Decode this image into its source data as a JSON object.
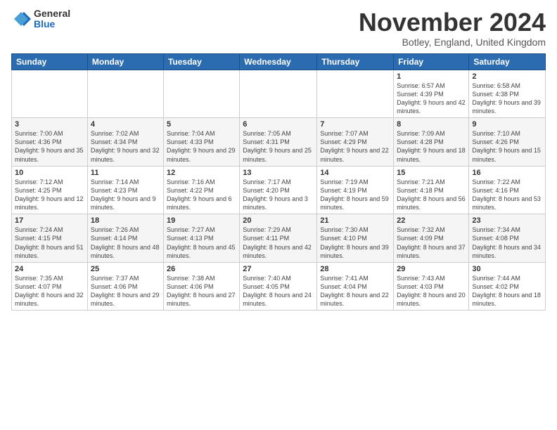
{
  "header": {
    "logo": {
      "general": "General",
      "blue": "Blue"
    },
    "title": "November 2024",
    "location": "Botley, England, United Kingdom"
  },
  "weekdays": [
    "Sunday",
    "Monday",
    "Tuesday",
    "Wednesday",
    "Thursday",
    "Friday",
    "Saturday"
  ],
  "weeks": [
    [
      {
        "day": "",
        "info": ""
      },
      {
        "day": "",
        "info": ""
      },
      {
        "day": "",
        "info": ""
      },
      {
        "day": "",
        "info": ""
      },
      {
        "day": "",
        "info": ""
      },
      {
        "day": "1",
        "info": "Sunrise: 6:57 AM\nSunset: 4:39 PM\nDaylight: 9 hours\nand 42 minutes."
      },
      {
        "day": "2",
        "info": "Sunrise: 6:58 AM\nSunset: 4:38 PM\nDaylight: 9 hours\nand 39 minutes."
      }
    ],
    [
      {
        "day": "3",
        "info": "Sunrise: 7:00 AM\nSunset: 4:36 PM\nDaylight: 9 hours\nand 35 minutes."
      },
      {
        "day": "4",
        "info": "Sunrise: 7:02 AM\nSunset: 4:34 PM\nDaylight: 9 hours\nand 32 minutes."
      },
      {
        "day": "5",
        "info": "Sunrise: 7:04 AM\nSunset: 4:33 PM\nDaylight: 9 hours\nand 29 minutes."
      },
      {
        "day": "6",
        "info": "Sunrise: 7:05 AM\nSunset: 4:31 PM\nDaylight: 9 hours\nand 25 minutes."
      },
      {
        "day": "7",
        "info": "Sunrise: 7:07 AM\nSunset: 4:29 PM\nDaylight: 9 hours\nand 22 minutes."
      },
      {
        "day": "8",
        "info": "Sunrise: 7:09 AM\nSunset: 4:28 PM\nDaylight: 9 hours\nand 18 minutes."
      },
      {
        "day": "9",
        "info": "Sunrise: 7:10 AM\nSunset: 4:26 PM\nDaylight: 9 hours\nand 15 minutes."
      }
    ],
    [
      {
        "day": "10",
        "info": "Sunrise: 7:12 AM\nSunset: 4:25 PM\nDaylight: 9 hours\nand 12 minutes."
      },
      {
        "day": "11",
        "info": "Sunrise: 7:14 AM\nSunset: 4:23 PM\nDaylight: 9 hours\nand 9 minutes."
      },
      {
        "day": "12",
        "info": "Sunrise: 7:16 AM\nSunset: 4:22 PM\nDaylight: 9 hours\nand 6 minutes."
      },
      {
        "day": "13",
        "info": "Sunrise: 7:17 AM\nSunset: 4:20 PM\nDaylight: 9 hours\nand 3 minutes."
      },
      {
        "day": "14",
        "info": "Sunrise: 7:19 AM\nSunset: 4:19 PM\nDaylight: 8 hours\nand 59 minutes."
      },
      {
        "day": "15",
        "info": "Sunrise: 7:21 AM\nSunset: 4:18 PM\nDaylight: 8 hours\nand 56 minutes."
      },
      {
        "day": "16",
        "info": "Sunrise: 7:22 AM\nSunset: 4:16 PM\nDaylight: 8 hours\nand 53 minutes."
      }
    ],
    [
      {
        "day": "17",
        "info": "Sunrise: 7:24 AM\nSunset: 4:15 PM\nDaylight: 8 hours\nand 51 minutes."
      },
      {
        "day": "18",
        "info": "Sunrise: 7:26 AM\nSunset: 4:14 PM\nDaylight: 8 hours\nand 48 minutes."
      },
      {
        "day": "19",
        "info": "Sunrise: 7:27 AM\nSunset: 4:13 PM\nDaylight: 8 hours\nand 45 minutes."
      },
      {
        "day": "20",
        "info": "Sunrise: 7:29 AM\nSunset: 4:11 PM\nDaylight: 8 hours\nand 42 minutes."
      },
      {
        "day": "21",
        "info": "Sunrise: 7:30 AM\nSunset: 4:10 PM\nDaylight: 8 hours\nand 39 minutes."
      },
      {
        "day": "22",
        "info": "Sunrise: 7:32 AM\nSunset: 4:09 PM\nDaylight: 8 hours\nand 37 minutes."
      },
      {
        "day": "23",
        "info": "Sunrise: 7:34 AM\nSunset: 4:08 PM\nDaylight: 8 hours\nand 34 minutes."
      }
    ],
    [
      {
        "day": "24",
        "info": "Sunrise: 7:35 AM\nSunset: 4:07 PM\nDaylight: 8 hours\nand 32 minutes."
      },
      {
        "day": "25",
        "info": "Sunrise: 7:37 AM\nSunset: 4:06 PM\nDaylight: 8 hours\nand 29 minutes."
      },
      {
        "day": "26",
        "info": "Sunrise: 7:38 AM\nSunset: 4:06 PM\nDaylight: 8 hours\nand 27 minutes."
      },
      {
        "day": "27",
        "info": "Sunrise: 7:40 AM\nSunset: 4:05 PM\nDaylight: 8 hours\nand 24 minutes."
      },
      {
        "day": "28",
        "info": "Sunrise: 7:41 AM\nSunset: 4:04 PM\nDaylight: 8 hours\nand 22 minutes."
      },
      {
        "day": "29",
        "info": "Sunrise: 7:43 AM\nSunset: 4:03 PM\nDaylight: 8 hours\nand 20 minutes."
      },
      {
        "day": "30",
        "info": "Sunrise: 7:44 AM\nSunset: 4:02 PM\nDaylight: 8 hours\nand 18 minutes."
      }
    ]
  ]
}
